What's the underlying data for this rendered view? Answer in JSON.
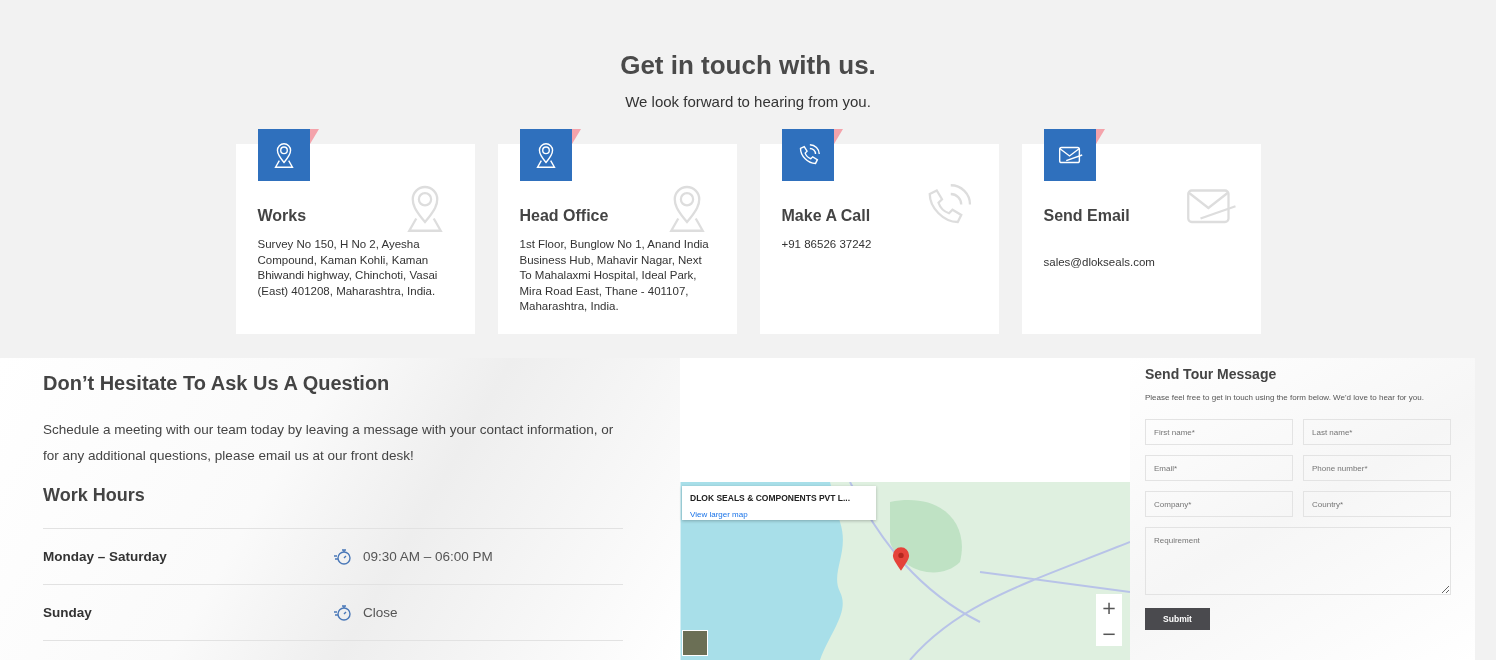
{
  "header": {
    "title": "Get in touch with us.",
    "subtitle": "We look forward to hearing from you."
  },
  "contact_cards": [
    {
      "kind": "location",
      "title": "Works",
      "text": "Survey No 150, H No 2, Ayesha Compound, Kaman Kohli, Kaman Bhiwandi highway, Chinchoti, Vasai (East) 401208, Maharashtra, India."
    },
    {
      "kind": "location",
      "title": "Head Office",
      "text": "1st Floor, Bunglow No 1, Anand India Business Hub, Mahavir Nagar, Next To Mahalaxmi Hospital, Ideal Park, Mira Road East, Thane - 401107, Maharashtra, India."
    },
    {
      "kind": "phone",
      "title": "Make A Call",
      "text": "+91 86526 37242"
    },
    {
      "kind": "email",
      "title": "Send Email",
      "text": "sales@dlokseals.com"
    }
  ],
  "question": {
    "title": "Don’t Hesitate To Ask Us A Question",
    "text": "Schedule a meeting with our team today by leaving a message with your contact information, or for any additional questions, please email us at our front desk!"
  },
  "work_hours": {
    "title": "Work Hours",
    "rows": [
      {
        "day": "Monday – Saturday",
        "hours": "09:30 AM – 06:00 PM"
      },
      {
        "day": "Sunday",
        "hours": "Close"
      }
    ]
  },
  "map": {
    "place_title": "DLOK SEALS & COMPONENTS PVT L...",
    "link": "View larger map",
    "zoom_in": "+",
    "zoom_out": "−"
  },
  "form": {
    "title": "Send Tour Message",
    "intro": "Please feel free to get in touch using the form below. We'd love to hear for you.",
    "fields": [
      {
        "kind": "input",
        "placeholder": "First name*"
      },
      {
        "kind": "input",
        "placeholder": "Last name*"
      },
      {
        "kind": "input",
        "placeholder": "Email*"
      },
      {
        "kind": "input",
        "placeholder": "Phone number*"
      },
      {
        "kind": "input",
        "placeholder": "Company*"
      },
      {
        "kind": "input",
        "placeholder": "Country*"
      },
      {
        "kind": "textarea",
        "placeholder": "Requirement"
      }
    ],
    "submit": "Submit"
  }
}
